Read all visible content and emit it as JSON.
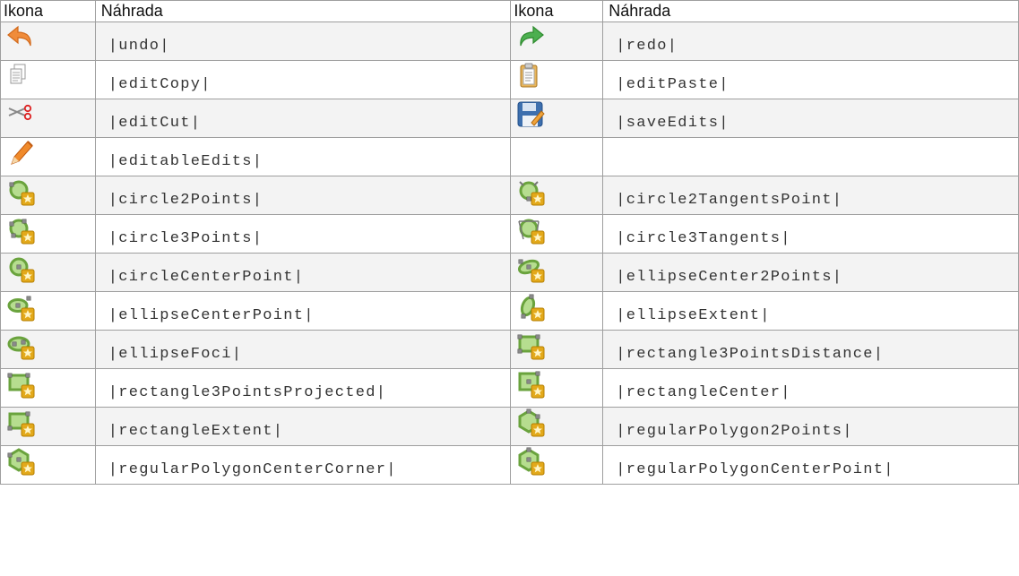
{
  "headers": {
    "icon": "Ikona",
    "replacement": "Náhrada"
  },
  "rows": [
    [
      {
        "icon": "undo-arrow-icon",
        "text": "|undo|"
      },
      {
        "icon": "redo-arrow-icon",
        "text": "|redo|"
      }
    ],
    [
      {
        "icon": "copy-document-icon",
        "text": "|editCopy|"
      },
      {
        "icon": "paste-clipboard-icon",
        "text": "|editPaste|"
      }
    ],
    [
      {
        "icon": "scissors-icon",
        "text": "|editCut|"
      },
      {
        "icon": "floppy-save-icon",
        "text": "|saveEdits|"
      }
    ],
    [
      {
        "icon": "pencil-icon",
        "text": "|editableEdits|"
      },
      {
        "icon": "",
        "text": ""
      }
    ],
    [
      {
        "icon": "circle-2-points-icon",
        "text": "|circle2Points|"
      },
      {
        "icon": "circle-2-tangents-point-icon",
        "text": "|circle2TangentsPoint|"
      }
    ],
    [
      {
        "icon": "circle-3-points-icon",
        "text": "|circle3Points|"
      },
      {
        "icon": "circle-3-tangents-icon",
        "text": "|circle3Tangents|"
      }
    ],
    [
      {
        "icon": "circle-center-point-icon",
        "text": "|circleCenterPoint|"
      },
      {
        "icon": "ellipse-center-2-points-icon",
        "text": "|ellipseCenter2Points|"
      }
    ],
    [
      {
        "icon": "ellipse-center-point-icon",
        "text": "|ellipseCenterPoint|"
      },
      {
        "icon": "ellipse-extent-icon",
        "text": "|ellipseExtent|"
      }
    ],
    [
      {
        "icon": "ellipse-foci-icon",
        "text": "|ellipseFoci|"
      },
      {
        "icon": "rectangle-3-points-distance-icon",
        "text": "|rectangle3PointsDistance|"
      }
    ],
    [
      {
        "icon": "rectangle-3-points-projected-icon",
        "text": "|rectangle3PointsProjected|"
      },
      {
        "icon": "rectangle-center-icon",
        "text": "|rectangleCenter|"
      }
    ],
    [
      {
        "icon": "rectangle-extent-icon",
        "text": "|rectangleExtent|"
      },
      {
        "icon": "regular-polygon-2-points-icon",
        "text": "|regularPolygon2Points|"
      }
    ],
    [
      {
        "icon": "regular-polygon-center-corner-icon",
        "text": "|regularPolygonCenterCorner|"
      },
      {
        "icon": "regular-polygon-center-point-icon",
        "text": "|regularPolygonCenterPoint|"
      }
    ]
  ]
}
